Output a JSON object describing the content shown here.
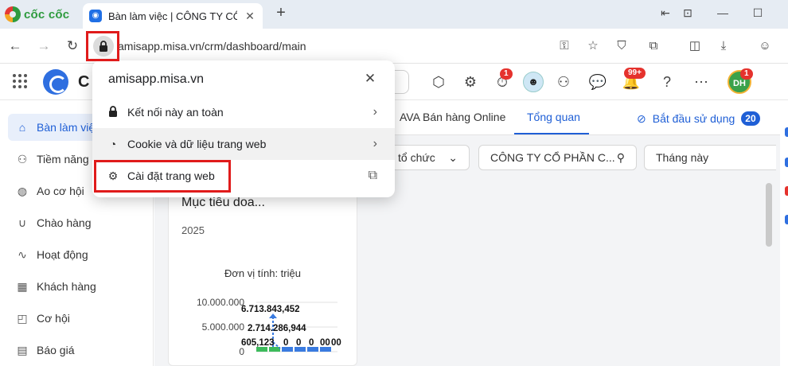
{
  "browser": {
    "brand": "cốc cốc",
    "tab_title": "Bàn làm việc | CÔNG TY CỔ",
    "url": "amisapp.misa.vn/crm/dashboard/main"
  },
  "app": {
    "name": "C",
    "notif_badge_timer": "1",
    "notif_badge_bell": "99+",
    "avatar_initials": "DH",
    "avatar_badge": "1"
  },
  "sidebar": {
    "items": [
      {
        "label": "Bàn làm việc",
        "icon": "home-icon"
      },
      {
        "label": "Tiềm năng",
        "icon": "leads-icon"
      },
      {
        "label": "Ao cơ hội",
        "icon": "pool-icon"
      },
      {
        "label": "Chào hàng",
        "icon": "magnet-icon"
      },
      {
        "label": "Hoạt động",
        "icon": "activity-icon"
      },
      {
        "label": "Khách hàng",
        "icon": "building-icon"
      },
      {
        "label": "Cơ hội",
        "icon": "opportunity-icon"
      },
      {
        "label": "Báo giá",
        "icon": "quote-icon"
      }
    ]
  },
  "main": {
    "tabs": [
      "AVA Bán hàng Online",
      "Tổng quan"
    ],
    "start_label": "Bắt đầu sử dụng",
    "start_count": "20",
    "filters": {
      "org": "tổ chức",
      "company": "CÔNG TY CỔ PHẦN C...",
      "period": "Tháng này"
    },
    "card": {
      "title": "Mục tiêu doa...",
      "year": "2025",
      "unit": "Đơn vị tính: triệu"
    }
  },
  "chart_data": {
    "type": "bar",
    "yticks": [
      "10.000.000",
      "5.000.000",
      "0"
    ],
    "data_labels": [
      "6.713.843,452",
      "2.714.286,944",
      "605,123",
      "0",
      "0",
      "0",
      "00",
      "00"
    ]
  },
  "popup": {
    "domain": "amisapp.misa.vn",
    "items": [
      {
        "label": "Kết nối này an toàn",
        "icon": "lock-icon",
        "arrow": true
      },
      {
        "label": "Cookie và dữ liệu trang web",
        "icon": "cookie-icon",
        "arrow": true
      },
      {
        "label": "Cài đặt trang web",
        "icon": "gear-icon",
        "arrow": false
      }
    ]
  }
}
